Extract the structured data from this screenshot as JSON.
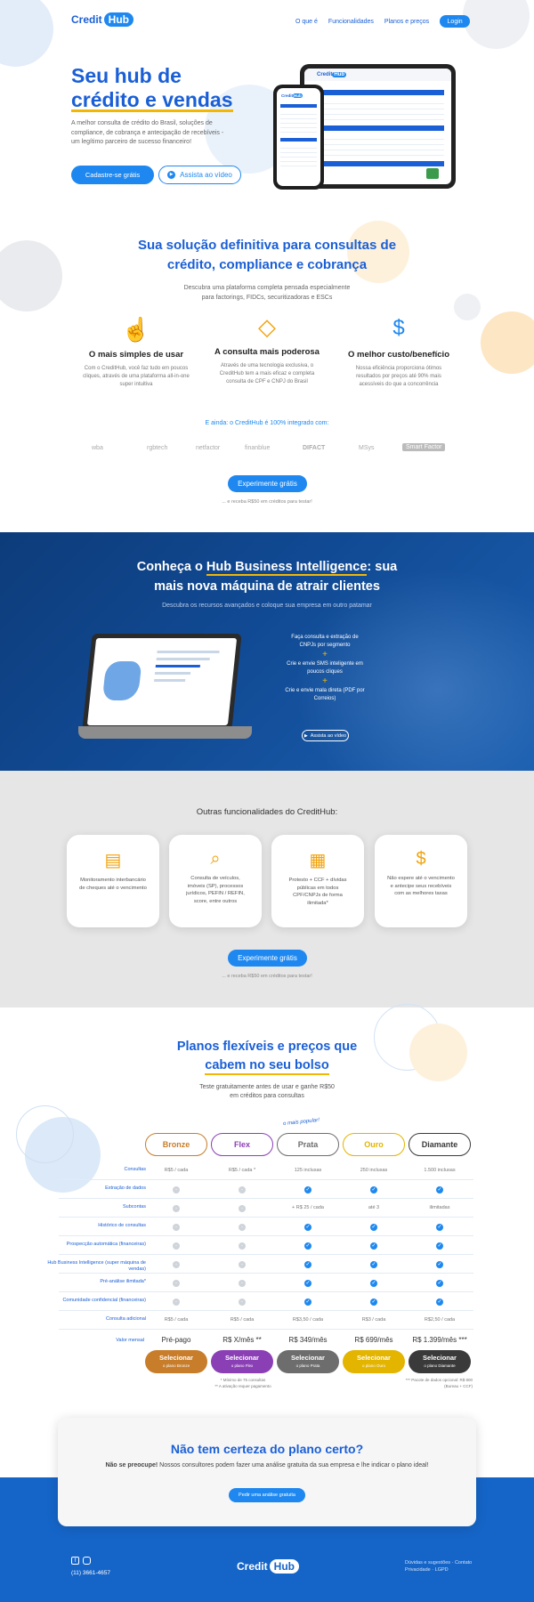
{
  "nav": {
    "logo_credit": "Credit",
    "logo_hub": "Hub",
    "links": [
      "O que é",
      "Funcionalidades",
      "Planos e preços"
    ],
    "login": "Login"
  },
  "hero": {
    "title_1": "Seu hub de",
    "title_2": "crédito e vendas",
    "desc": "A melhor consulta de crédito do Brasil, soluções de compliance, de cobrança e antecipação de recebíveis - um legítimo parceiro de sucesso financeiro!",
    "cta": "Cadastre-se grátis",
    "video": "Assista ao vídeo"
  },
  "solution": {
    "title_1": "Sua solução definitiva para consultas de",
    "title_2": "crédito, compliance e cobrança",
    "desc_1": "Descubra uma plataforma completa pensada especialmente",
    "desc_2": "para factorings, FIDCs, securitizadoras e ESCs",
    "features": [
      {
        "title": "O mais simples de usar",
        "desc": "Com o CreditHub, você faz tudo em poucos cliques, através de uma plataforma all-in-one super intuitiva"
      },
      {
        "title": "A consulta mais poderosa",
        "desc": "Através de uma tecnologia exclusiva, o CreditHub tem a mais eficaz e completa consulta de CPF e CNPJ do Brasil"
      },
      {
        "title": "O melhor custo/benefício",
        "desc": "Nossa eficiência proporciona ótimos resultados por preços até 90% mais acessíveis do que a concorrência"
      }
    ],
    "integrated": "E ainda: o CreditHub é 100% integrado com:",
    "partners": [
      "wba",
      "rgbtech",
      "netfactor",
      "finanblue",
      "DIFACT",
      "MSys",
      "Smart Factor"
    ],
    "cta": "Experimente grátis",
    "note": "... e receba R$50 em créditos para testar!"
  },
  "hbi": {
    "title_1": "Conheça o ",
    "title_hl": "Hub Business Intelligence",
    "title_2": ": sua",
    "title_3": "mais nova máquina de atrair clientes",
    "desc": "Descubra os recursos avançados e coloque sua empresa em outro patamar",
    "items": [
      "Faça consulta e extração de CNPJs por segmento",
      "Crie e envie SMS inteligente em poucos cliques",
      "Crie e envie mala direta (PDF por Correios)"
    ],
    "video": "Assista ao vídeo"
  },
  "other": {
    "title": "Outras funcionalidades do CreditHub:",
    "cards": [
      "Monitoramento interbancário de cheques até o vencimento",
      "Consulta de veículos, imóveis (SP), processos jurídicos, PEFIN / REFIN, score, entre outros",
      "Protesto + CCF + dívidas públicas em todos CPF/CNPJs de forma ilimitada*",
      "Não espere até o vencimento e antecipe seus recebíveis com as melhores taxas"
    ],
    "cta": "Experimente grátis",
    "note": "... e receba R$50 em créditos para testar!"
  },
  "plans": {
    "title_1": "Planos flexíveis e preços que",
    "title_2": "cabem no seu bolso",
    "desc_1": "Teste gratuitamente antes de usar e ganhe R$50",
    "desc_2": "em créditos para consultas",
    "popular": "o mais popular!",
    "names": [
      "Bronze",
      "Flex",
      "Prata",
      "Ouro",
      "Diamante"
    ],
    "colors": [
      "#c77d2a",
      "#8a3fb5",
      "#6d6d6d",
      "#e3b400",
      "#3a3a3a"
    ],
    "rows": [
      {
        "label": "Consultas",
        "cells": [
          "R$5 / cada",
          "R$5 / cada *",
          "125 inclusas",
          "250 inclusas",
          "1.500 inclusas"
        ]
      },
      {
        "label": "Extração de dados",
        "cells": [
          "-",
          "-",
          "✓",
          "✓",
          "✓"
        ]
      },
      {
        "label": "Subcontas",
        "cells": [
          "-",
          "-",
          "+ R$ 25 / cada",
          "até 3",
          "ilimitadas"
        ]
      },
      {
        "label": "Histórico de consultas",
        "cells": [
          "-",
          "-",
          "✓",
          "✓",
          "✓"
        ]
      },
      {
        "label": "Prospecção automática (financeiras)",
        "cells": [
          "-",
          "-",
          "✓",
          "✓",
          "✓"
        ]
      },
      {
        "label": "Hub Business Intelligence (super máquina de vendas)",
        "cells": [
          "-",
          "-",
          "✓",
          "✓",
          "✓"
        ]
      },
      {
        "label": "Pré-análise ilimitada*",
        "cells": [
          "-",
          "-",
          "✓",
          "✓",
          "✓"
        ]
      },
      {
        "label": "Comunidade confidencial (financeiras)",
        "cells": [
          "-",
          "-",
          "✓",
          "✓",
          "✓"
        ]
      },
      {
        "label": "Consulta adicional",
        "cells": [
          "R$5 / cada",
          "R$5 / cada",
          "R$3,50 / cada",
          "R$3 / cada",
          "R$2,50 / cada"
        ]
      }
    ],
    "value_label": "Valor mensal",
    "prices": [
      "Pré-pago",
      "R$ X/mês **",
      "R$ 349/mês",
      "R$ 699/mês",
      "R$ 1.399/mês ***"
    ],
    "select": "Selecionar",
    "select_sub": [
      "o plano Bronze",
      "o plano Flex",
      "o plano Prata",
      "o plano Ouro",
      "o plano Diamante"
    ],
    "footnote_1": "* Mínimo de 75 consultas",
    "footnote_2": "** A ativação requer pagamento",
    "footnote_3": "*** Pacote de dados opcional: R$ 800 (Bureau + CCF)"
  },
  "cta_box": {
    "title": "Não tem certeza do plano certo?",
    "desc_bold": "Não se preocupe!",
    "desc": " Nossos consultores podem fazer uma análise gratuita da sua empresa e lhe indicar o plano ideal!",
    "button": "Pedir uma análise gratuita"
  },
  "footer": {
    "phone": "(11) 3661-4657",
    "links": [
      "Dúvidas e sugestões",
      "Contato",
      "Privacidade",
      "LGPD"
    ]
  }
}
